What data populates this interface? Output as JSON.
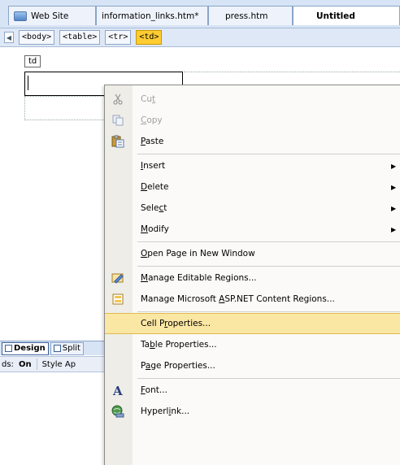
{
  "tabs": [
    {
      "label": "Web Site",
      "active": false
    },
    {
      "label": "information_links.htm*",
      "active": false
    },
    {
      "label": "press.htm",
      "active": false
    },
    {
      "label": "Untitled",
      "active": true
    }
  ],
  "tag_selector": {
    "tags": [
      "<body>",
      "<table>",
      "<tr>",
      "<td>"
    ],
    "active_tag": "<td>"
  },
  "canvas": {
    "cell_tag_label": "td"
  },
  "view_bar": {
    "design": "Design",
    "split": "Split"
  },
  "pane_bar": {
    "left_text": "ds:",
    "on_label": "On",
    "style_label": "Style Ap"
  },
  "context_menu": {
    "cut": {
      "pre": "Cu",
      "ul": "t",
      "post": ""
    },
    "copy": {
      "pre": "",
      "ul": "C",
      "post": "opy"
    },
    "paste": {
      "pre": "",
      "ul": "P",
      "post": "aste"
    },
    "insert": {
      "pre": "",
      "ul": "I",
      "post": "nsert"
    },
    "delete": {
      "pre": "",
      "ul": "D",
      "post": "elete"
    },
    "select": {
      "pre": "Sele",
      "ul": "c",
      "post": "t"
    },
    "modify": {
      "pre": "",
      "ul": "M",
      "post": "odify"
    },
    "open_page": {
      "pre": "",
      "ul": "O",
      "post": "pen Page in New Window"
    },
    "manage_editable": {
      "pre": "",
      "ul": "M",
      "post": "anage Editable Regions..."
    },
    "manage_aspnet": {
      "pre": "Manage Microsoft ",
      "ul": "A",
      "post": "SP.NET Content Regions..."
    },
    "cell_properties": {
      "pre": "Cell P",
      "ul": "r",
      "post": "operties..."
    },
    "table_properties": {
      "pre": "Ta",
      "ul": "b",
      "post": "le Properties..."
    },
    "page_properties": {
      "pre": "P",
      "ul": "a",
      "post": "ge Properties..."
    },
    "font": {
      "pre": "",
      "ul": "F",
      "post": "ont..."
    },
    "hyperlink": {
      "pre": "Hyperl",
      "ul": "i",
      "post": "nk..."
    }
  },
  "colors": {
    "hover_highlight": "#fbe7a4",
    "active_tag": "#ffcc33"
  }
}
